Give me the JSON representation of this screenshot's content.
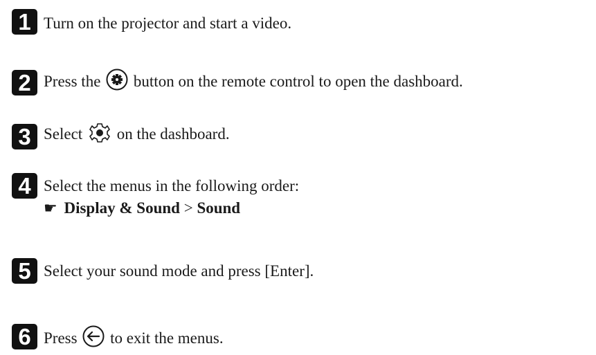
{
  "steps": [
    {
      "number": "1",
      "text": "Turn on the projector and start a video."
    },
    {
      "number": "2",
      "before": "Press the",
      "icon": "settings-gear-button-icon",
      "after": "button on the remote control to open the dashboard."
    },
    {
      "number": "3",
      "before": "Select",
      "icon": "settings-gear-icon",
      "after": "on the dashboard."
    },
    {
      "number": "4",
      "text": "Select the menus in the following order:",
      "path": {
        "pointer": "☛",
        "menu": "Display & Sound",
        "separator": ">",
        "submenu": "Sound"
      }
    },
    {
      "number": "5",
      "text": "Select your sound mode and press [Enter]."
    },
    {
      "number": "6",
      "before": "Press",
      "icon": "back-arrow-button-icon",
      "after": "to exit the menus."
    }
  ]
}
